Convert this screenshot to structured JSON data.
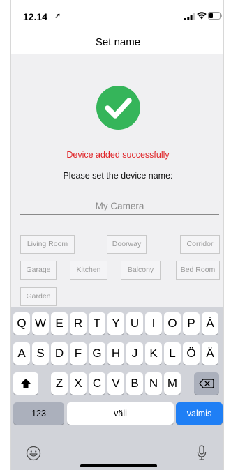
{
  "status_bar": {
    "time": "12.14",
    "location_icon": "location-arrow-icon",
    "signal_icon": "signal-icon",
    "wifi_icon": "wifi-icon",
    "battery_icon": "battery-icon"
  },
  "nav": {
    "title": "Set name"
  },
  "main": {
    "success_icon": "check-circle-icon",
    "success_color": "#35b55a",
    "success_message": "Device added successfully",
    "success_message_color": "#e0262a",
    "prompt": "Please set the device name:",
    "name_placeholder": "My Camera",
    "presets": [
      "Living Room",
      "Doorway",
      "Corridor",
      "Garage",
      "Kitchen",
      "Balcony",
      "Bed Room",
      "Garden"
    ]
  },
  "keyboard": {
    "row1": [
      "Q",
      "W",
      "E",
      "R",
      "T",
      "Y",
      "U",
      "I",
      "O",
      "P",
      "Å"
    ],
    "row2": [
      "A",
      "S",
      "D",
      "F",
      "G",
      "H",
      "J",
      "K",
      "L",
      "Ö",
      "Ä"
    ],
    "row3": [
      "Z",
      "X",
      "C",
      "V",
      "B",
      "N",
      "M"
    ],
    "shift_icon": "shift-arrow-icon",
    "backspace_icon": "backspace-icon",
    "numbers_label": "123",
    "space_label": "väli",
    "done_label": "valmis",
    "done_color": "#1f7ff5",
    "emoji_icon": "emoji-icon",
    "mic_icon": "microphone-icon"
  }
}
